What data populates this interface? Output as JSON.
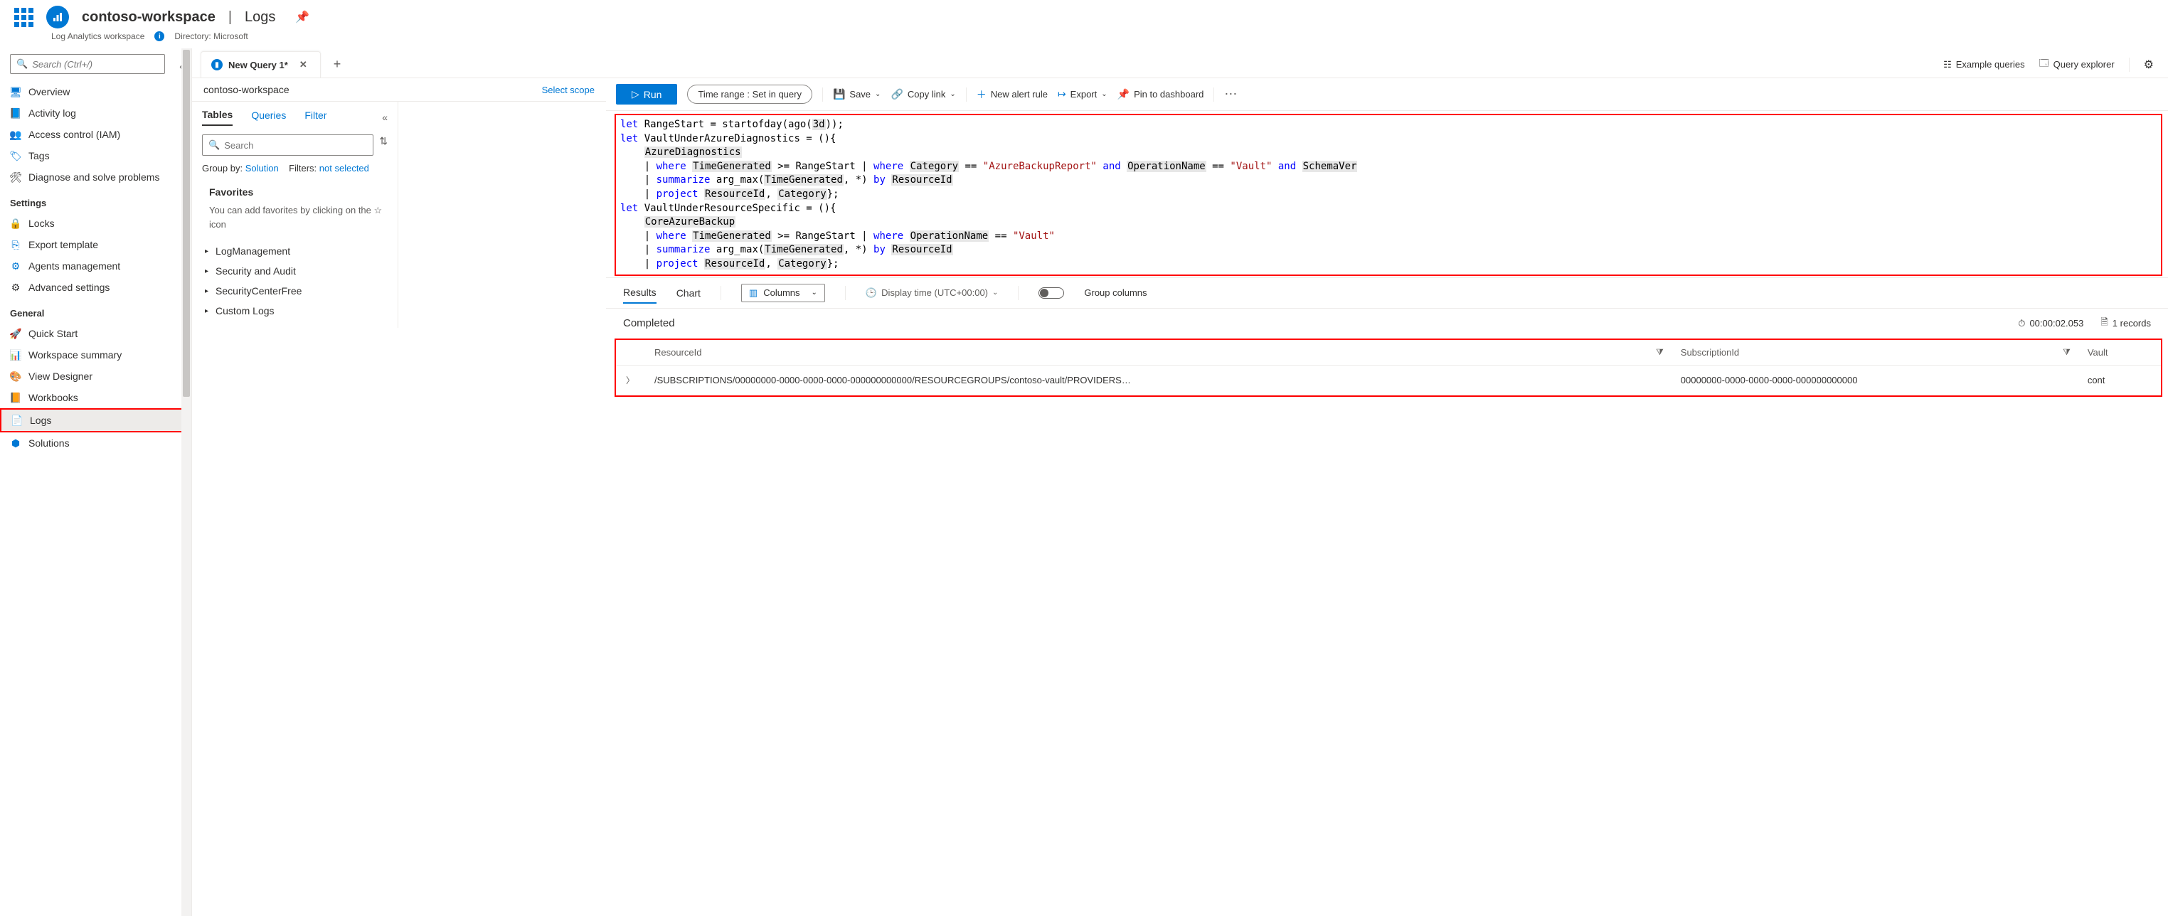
{
  "header": {
    "workspace_name": "contoso-workspace",
    "section": "Logs",
    "subtitle": "Log Analytics workspace",
    "directory_label": "Directory: Microsoft"
  },
  "search": {
    "placeholder": "Search (Ctrl+/)"
  },
  "nav": {
    "items": [
      {
        "label": "Overview",
        "icon": "🖥",
        "color": "#0078d4"
      },
      {
        "label": "Activity log",
        "icon": "📘",
        "color": "#0078d4"
      },
      {
        "label": "Access control (IAM)",
        "icon": "👥",
        "color": "#0078d4"
      },
      {
        "label": "Tags",
        "icon": "🏷",
        "color": "#0078d4"
      },
      {
        "label": "Diagnose and solve problems",
        "icon": "🛠",
        "color": "#323130"
      }
    ],
    "settings_label": "Settings",
    "settings": [
      {
        "label": "Locks",
        "icon": "🔒",
        "color": "#0078d4"
      },
      {
        "label": "Export template",
        "icon": "⎘",
        "color": "#0078d4"
      },
      {
        "label": "Agents management",
        "icon": "⚙",
        "color": "#0078d4"
      },
      {
        "label": "Advanced settings",
        "icon": "⚙",
        "color": "#323130"
      }
    ],
    "general_label": "General",
    "general": [
      {
        "label": "Quick Start",
        "icon": "🚀",
        "color": "#0078d4"
      },
      {
        "label": "Workspace summary",
        "icon": "📊",
        "color": "#0078d4"
      },
      {
        "label": "View Designer",
        "icon": "🎨",
        "color": "#0078d4"
      },
      {
        "label": "Workbooks",
        "icon": "📙",
        "color": "#be5504"
      },
      {
        "label": "Logs",
        "icon": "📄",
        "color": "#0078d4",
        "active": true,
        "highlight": true
      },
      {
        "label": "Solutions",
        "icon": "⬢",
        "color": "#0078d4"
      }
    ]
  },
  "query_tab": {
    "label": "New Query 1*"
  },
  "right_links": {
    "example": "Example queries",
    "explorer": "Query explorer"
  },
  "scope": {
    "name": "contoso-workspace",
    "select": "Select scope"
  },
  "panel": {
    "tabs": [
      "Tables",
      "Queries",
      "Filter"
    ],
    "search_placeholder": "Search",
    "groupby_label": "Group by:",
    "groupby_value": "Solution",
    "filters_label": "Filters:",
    "filters_value": "not selected",
    "favorites_title": "Favorites",
    "favorites_desc": "You can add favorites by clicking on the ☆ icon",
    "tree": [
      "LogManagement",
      "Security and Audit",
      "SecurityCenterFree",
      "Custom Logs"
    ]
  },
  "toolbar": {
    "run": "Run",
    "timerange_label": "Time range :",
    "timerange_value": "Set in query",
    "save": "Save",
    "copy": "Copy link",
    "newalert": "New alert rule",
    "export": "Export",
    "pin": "Pin to dashboard"
  },
  "editor_lines": [
    [
      {
        "t": "let",
        "c": "kw"
      },
      {
        "t": " RangeStart = startofday(ago("
      },
      {
        "t": "3d",
        "c": "fld"
      },
      {
        "t": "));"
      }
    ],
    [
      {
        "t": "let",
        "c": "kw"
      },
      {
        "t": " VaultUnderAzureDiagnostics = (){"
      }
    ],
    [
      {
        "t": "    "
      },
      {
        "t": "AzureDiagnostics",
        "c": "fld"
      }
    ],
    [
      {
        "t": "    | "
      },
      {
        "t": "where",
        "c": "kw"
      },
      {
        "t": " "
      },
      {
        "t": "TimeGenerated",
        "c": "fld"
      },
      {
        "t": " >= RangeStart | "
      },
      {
        "t": "where",
        "c": "kw"
      },
      {
        "t": " "
      },
      {
        "t": "Category",
        "c": "fld"
      },
      {
        "t": " == "
      },
      {
        "t": "\"AzureBackupReport\"",
        "c": "str"
      },
      {
        "t": " "
      },
      {
        "t": "and",
        "c": "kw"
      },
      {
        "t": " "
      },
      {
        "t": "OperationName",
        "c": "fld"
      },
      {
        "t": " == "
      },
      {
        "t": "\"Vault\"",
        "c": "str"
      },
      {
        "t": " "
      },
      {
        "t": "and",
        "c": "kw"
      },
      {
        "t": " "
      },
      {
        "t": "SchemaVer",
        "c": "fld"
      }
    ],
    [
      {
        "t": "    | "
      },
      {
        "t": "summarize",
        "c": "kw"
      },
      {
        "t": " arg_max("
      },
      {
        "t": "TimeGenerated",
        "c": "fld"
      },
      {
        "t": ", *) "
      },
      {
        "t": "by",
        "c": "kw"
      },
      {
        "t": " "
      },
      {
        "t": "ResourceId",
        "c": "fld"
      }
    ],
    [
      {
        "t": "    | "
      },
      {
        "t": "project",
        "c": "kw"
      },
      {
        "t": " "
      },
      {
        "t": "ResourceId",
        "c": "fld"
      },
      {
        "t": ", "
      },
      {
        "t": "Category",
        "c": "fld"
      },
      {
        "t": "};"
      }
    ],
    [
      {
        "t": "let",
        "c": "kw"
      },
      {
        "t": " VaultUnderResourceSpecific = (){"
      }
    ],
    [
      {
        "t": "    "
      },
      {
        "t": "CoreAzureBackup",
        "c": "fld"
      }
    ],
    [
      {
        "t": "    | "
      },
      {
        "t": "where",
        "c": "kw"
      },
      {
        "t": " "
      },
      {
        "t": "TimeGenerated",
        "c": "fld"
      },
      {
        "t": " >= RangeStart | "
      },
      {
        "t": "where",
        "c": "kw"
      },
      {
        "t": " "
      },
      {
        "t": "OperationName",
        "c": "fld"
      },
      {
        "t": " == "
      },
      {
        "t": "\"Vault\"",
        "c": "str"
      }
    ],
    [
      {
        "t": "    | "
      },
      {
        "t": "summarize",
        "c": "kw"
      },
      {
        "t": " arg_max("
      },
      {
        "t": "TimeGenerated",
        "c": "fld"
      },
      {
        "t": ", *) "
      },
      {
        "t": "by",
        "c": "kw"
      },
      {
        "t": " "
      },
      {
        "t": "ResourceId",
        "c": "fld"
      }
    ],
    [
      {
        "t": "    | "
      },
      {
        "t": "project",
        "c": "kw"
      },
      {
        "t": " "
      },
      {
        "t": "ResourceId",
        "c": "fld"
      },
      {
        "t": ", "
      },
      {
        "t": "Category",
        "c": "fld"
      },
      {
        "t": "};"
      }
    ]
  ],
  "results_toolbar": {
    "tabs": [
      "Results",
      "Chart"
    ],
    "columns": "Columns",
    "display_time": "Display time (UTC+00:00)",
    "group": "Group columns"
  },
  "status": {
    "label": "Completed",
    "duration": "00:00:02.053",
    "records": "1 records"
  },
  "table": {
    "headers": [
      "ResourceId",
      "SubscriptionId",
      "Vault"
    ],
    "row": {
      "resource": "/SUBSCRIPTIONS/00000000-0000-0000-0000-000000000000/RESOURCEGROUPS/contoso-vault/PROVIDERS…",
      "subscription": "00000000-0000-0000-0000-000000000000",
      "vault": "cont"
    }
  }
}
